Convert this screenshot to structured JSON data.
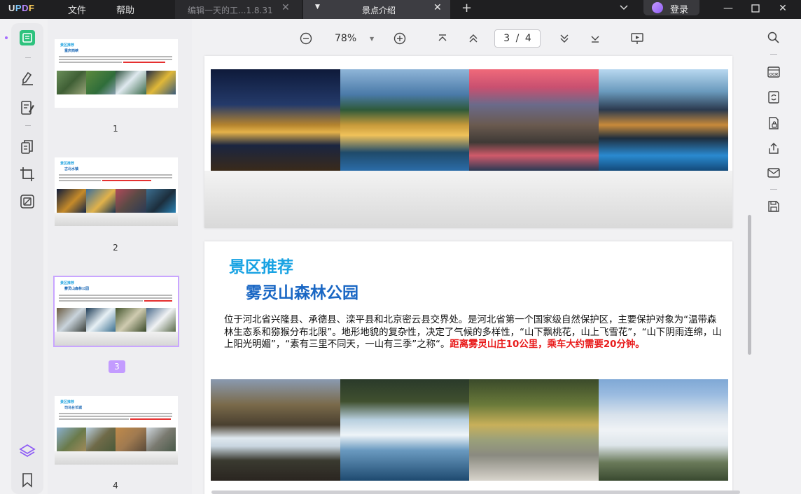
{
  "app": {
    "logo": [
      "U",
      "P",
      "D",
      "F"
    ],
    "menu": {
      "file": "文件",
      "help": "帮助"
    },
    "tabs": [
      {
        "label": "编辑一天的工...1.8.31",
        "active": false
      },
      {
        "label": "景点介绍",
        "active": true
      }
    ],
    "login_label": "登录",
    "icons": [
      "search-icon",
      "ocr-icon",
      "convert-icon",
      "protect-icon",
      "share-icon",
      "mail-icon",
      "save-icon"
    ]
  },
  "toolbar": {
    "zoom": "78%",
    "current_page": "3",
    "page_separator": "/",
    "total_pages": "4"
  },
  "thumbnails": [
    {
      "num": "1",
      "h1": "景区推荐",
      "h2": "重庆西峡",
      "selected": false
    },
    {
      "num": "2",
      "h1": "景区推荐",
      "h2": "古北水镇",
      "selected": false
    },
    {
      "num": "3",
      "h1": "景区推荐",
      "h2": "雾灵山森林公园",
      "selected": true
    },
    {
      "num": "4",
      "h1": "景区推荐",
      "h2": "司马台长城",
      "selected": false
    }
  ],
  "page3": {
    "title": "景区推荐",
    "subtitle": "雾灵山森林公园",
    "body": "位于河北省兴隆县、承德县、滦平县和北京密云县交界处。是河北省第一个国家级自然保护区，主要保护对象为“温带森林生态系和猕猴分布北限”。地形地貌的复杂性，决定了气候的多样性，“山下飘桃花，山上飞雪花”，“山下阴雨连绵，山上阳光明媚”，“素有三里不同天，一山有三季”之称“。",
    "highlight": "距离雾灵山庄10公里，乘车大约需要20分钟。"
  },
  "colors": {
    "accent": "#b889ff",
    "title_blue": "#1aa3e3",
    "subtitle_blue": "#1a67c4",
    "highlight_red": "#e81a1a"
  }
}
